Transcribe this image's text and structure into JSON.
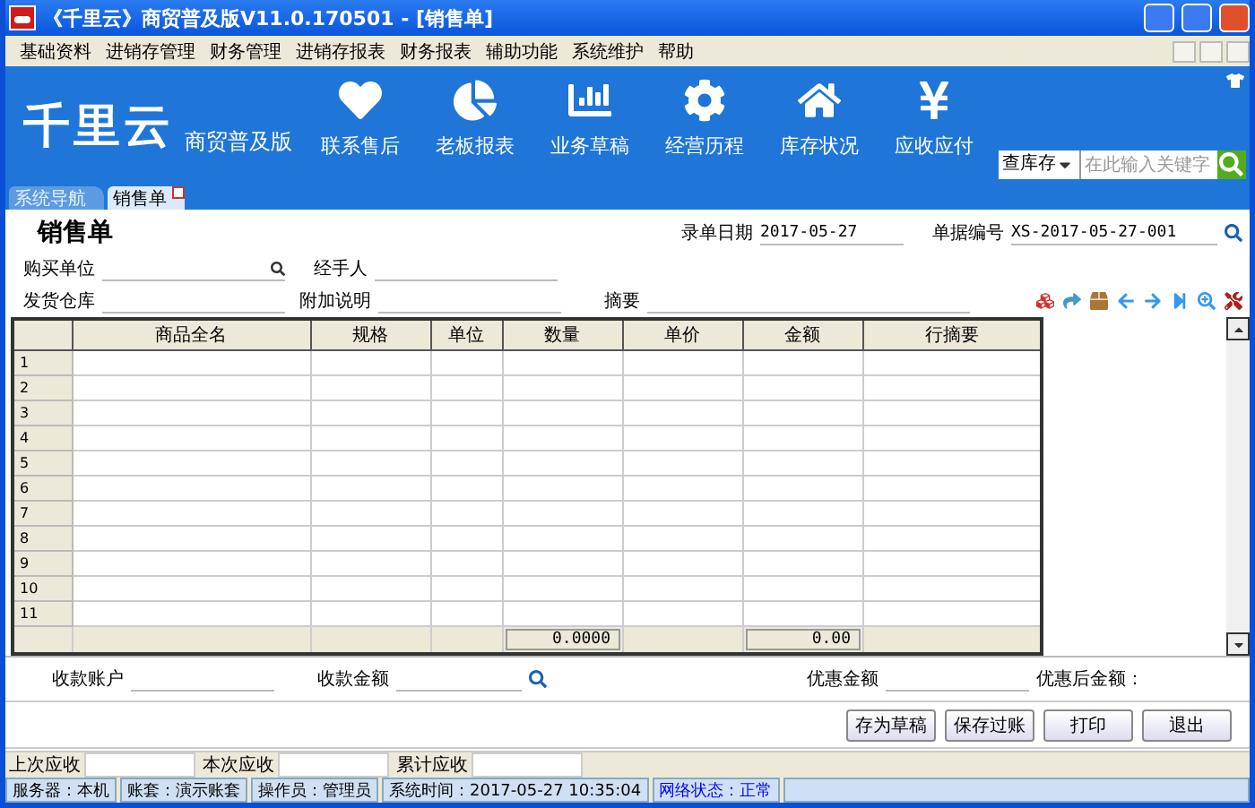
{
  "window": {
    "title": "《千里云》商贸普及版V11.0.170501 - [销售单]"
  },
  "menu": [
    "基础资料",
    "进销存管理",
    "财务管理",
    "进销存报表",
    "财务报表",
    "辅助功能",
    "系统维护",
    "帮助"
  ],
  "brand": {
    "logo": "千里云",
    "edition": "商贸普及版"
  },
  "nav": [
    {
      "kind": "heart",
      "label": "联系售后"
    },
    {
      "kind": "pie",
      "label": "老板报表"
    },
    {
      "kind": "bars",
      "label": "业务草稿"
    },
    {
      "kind": "gear",
      "label": "经营历程"
    },
    {
      "kind": "house",
      "label": "库存状况"
    },
    {
      "kind": "yen",
      "label": "应收应付"
    }
  ],
  "search": {
    "scope": "查库存",
    "placeholder": "在此输入关键字"
  },
  "tabs": [
    {
      "label": "系统导航",
      "selected": false
    },
    {
      "label": "销售单",
      "selected": true
    }
  ],
  "form": {
    "title": "销售单",
    "date_label": "录单日期",
    "date": "2017-05-27",
    "number_label": "单据编号",
    "number": "XS-2017-05-27-001",
    "buyer_label": "购买单位",
    "handler_label": "经手人",
    "warehouse_label": "发货仓库",
    "note_label": "附加说明",
    "summary_label": "摘要"
  },
  "grid": {
    "columns": [
      "商品全名",
      "规格",
      "单位",
      "数量",
      "单价",
      "金额",
      "行摘要"
    ],
    "rows": [
      "1",
      "2",
      "3",
      "4",
      "5",
      "6",
      "7",
      "8",
      "9",
      "10",
      "11"
    ],
    "total_quantity": "0.0000",
    "total_amount": "0.00"
  },
  "payment": {
    "account_label": "收款账户",
    "amount_label": "收款金额",
    "discount_label": "优惠金额",
    "after_discount_label": "优惠后金额："
  },
  "buttons": [
    "存为草稿",
    "保存过账",
    "打印",
    "退出"
  ],
  "receivables": [
    "上次应收",
    "本次应收",
    "累计应收"
  ],
  "status_bar": [
    {
      "text": "服务器：本机",
      "color": "#000000"
    },
    {
      "text": "账套：演示账套",
      "color": "#000000"
    },
    {
      "text": "操作员：管理员",
      "color": "#000000"
    },
    {
      "text": "系统时间：2017-05-27 10:35:04",
      "color": "#000000"
    },
    {
      "text": "网络状态：正常",
      "color": "#0000ff"
    }
  ]
}
